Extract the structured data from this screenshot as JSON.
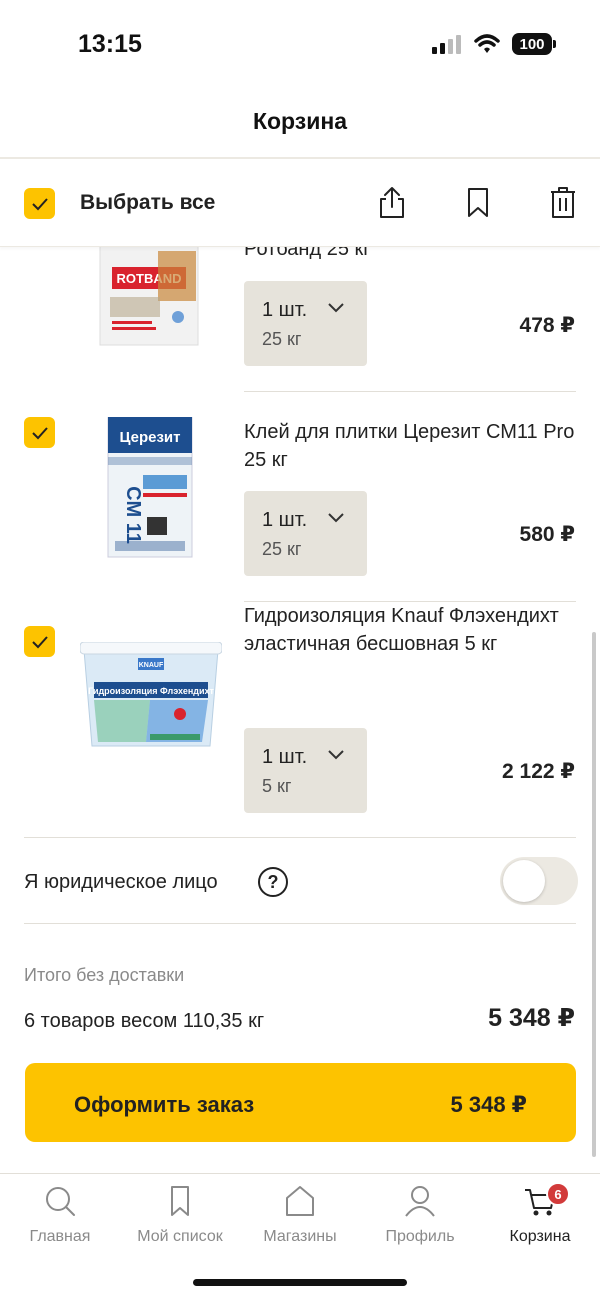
{
  "status_bar": {
    "time": "13:15",
    "battery": "100"
  },
  "header": {
    "title": "Корзина"
  },
  "select_bar": {
    "select_all_label": "Выбрать все"
  },
  "items": [
    {
      "title": "Ротбанд 25 кг",
      "brand_label": "ROTBAND",
      "quantity": "1 шт.",
      "weight": "25 кг",
      "price": "478 ₽",
      "checked": false
    },
    {
      "title": "Клей для плитки Церезит СМ11 Pro 25 кг",
      "brand_label": "Церезит",
      "product_code": "CM 11",
      "quantity": "1 шт.",
      "weight": "25 кг",
      "price": "580 ₽",
      "checked": true
    },
    {
      "title": "Гидроизоляция Knauf Флэхендихт эластичная бесшовная 5 кг",
      "brand_label": "KNAUF",
      "product_label": "Гидроизоляция Флэхендихт",
      "quantity": "1 шт.",
      "weight": "5 кг",
      "price": "2 122 ₽",
      "checked": true
    }
  ],
  "legal_entity": {
    "label": "Я юридическое лицо",
    "help": "?",
    "enabled": false
  },
  "summary": {
    "caption": "Итого без доставки",
    "description": "6 товаров весом 110,35 кг",
    "total": "5 348 ₽"
  },
  "order_button": {
    "label": "Оформить заказ",
    "price": "5 348 ₽"
  },
  "tabbar": {
    "tabs": [
      {
        "label": "Главная",
        "icon": "search-icon"
      },
      {
        "label": "Мой список",
        "icon": "bookmark-icon"
      },
      {
        "label": "Магазины",
        "icon": "store-icon"
      },
      {
        "label": "Профиль",
        "icon": "profile-icon"
      },
      {
        "label": "Корзина",
        "icon": "cart-icon",
        "badge": "6",
        "active": true
      }
    ]
  },
  "colors": {
    "accent": "#fdc300",
    "badge": "#d23a3a",
    "qty_bg": "#e6e3db"
  }
}
